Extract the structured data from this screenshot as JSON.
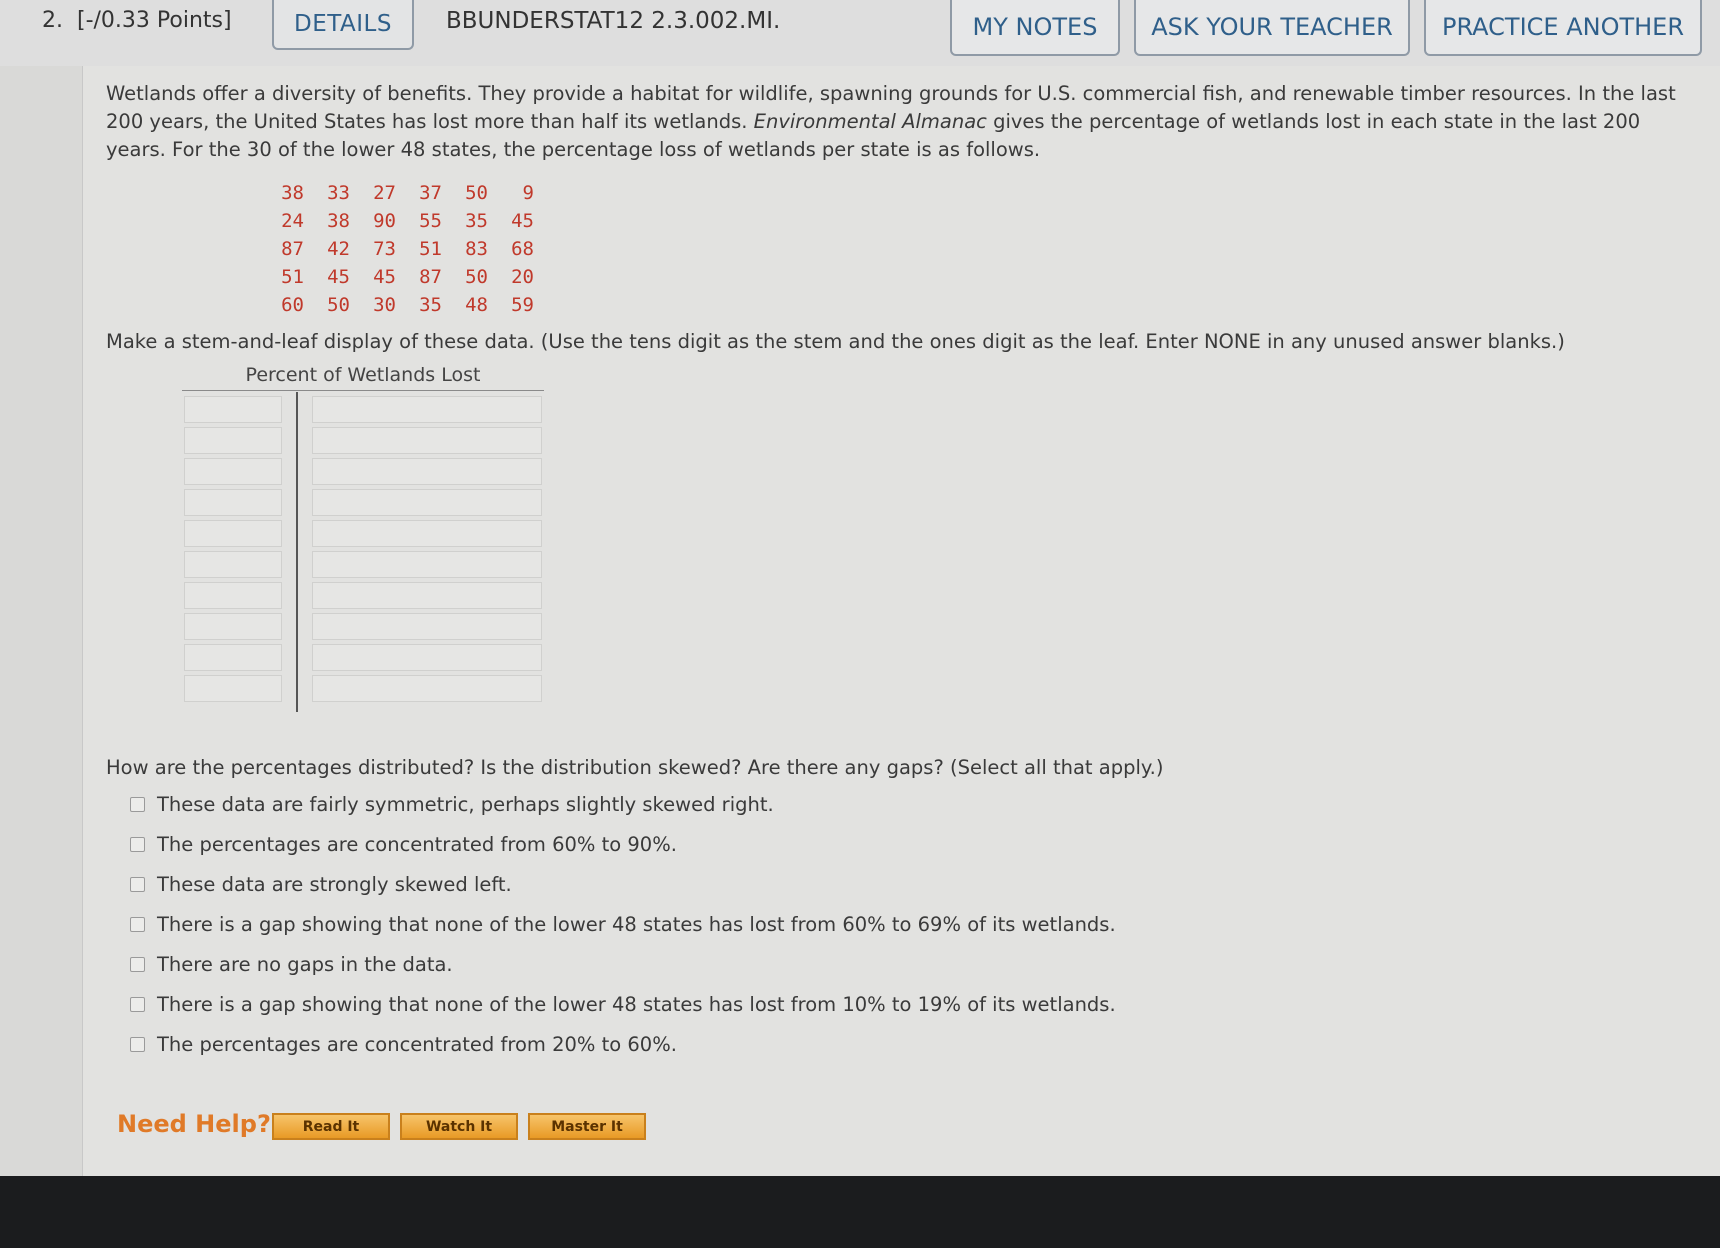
{
  "header": {
    "question_number": "2.",
    "points": "[-/0.33 Points]",
    "details": "DETAILS",
    "code": "BBUNDERSTAT12 2.3.002.MI.",
    "my_notes": "MY NOTES",
    "ask_teacher": "ASK YOUR TEACHER",
    "practice_another": "PRACTICE ANOTHER"
  },
  "problem": {
    "intro_part1": "Wetlands offer a diversity of benefits. They provide a habitat for wildlife, spawning grounds for U.S. commercial fish, and renewable timber resources. In the last 200 years, the United States has lost more than half its wetlands.",
    "source_italic": "Environmental Almanac",
    "intro_part2": "gives the percentage of wetlands lost in each state in the last 200 years. For the 30 of the lower 48 states, the percentage loss of wetlands per state is as follows.",
    "data_rows": [
      [
        "38",
        "33",
        "27",
        "37",
        "50",
        "9"
      ],
      [
        "24",
        "38",
        "90",
        "55",
        "35",
        "45"
      ],
      [
        "87",
        "42",
        "73",
        "51",
        "83",
        "68"
      ],
      [
        "51",
        "45",
        "45",
        "87",
        "50",
        "20"
      ],
      [
        "60",
        "50",
        "30",
        "35",
        "48",
        "59"
      ]
    ],
    "instruction": "Make a stem-and-leaf display of these data. (Use the tens digit as the stem and the ones digit as the leaf. Enter NONE in any unused answer blanks.)",
    "table_title": "Percent of Wetlands Lost"
  },
  "mc": {
    "question": "How are the percentages distributed? Is the distribution skewed? Are there any gaps? (Select all that apply.)",
    "options": [
      "These data are fairly symmetric, perhaps slightly skewed right.",
      "The percentages are concentrated from 60% to 90%.",
      "These data are strongly skewed left.",
      "There is a gap showing that none of the lower 48 states has lost from 60% to 69% of its wetlands.",
      "There are no gaps in the data.",
      "There is a gap showing that none of the lower 48 states has lost from 10% to 19% of its wetlands.",
      "The percentages are concentrated from 20% to 60%."
    ]
  },
  "help": {
    "label": "Need Help?",
    "read": "Read It",
    "watch": "Watch It",
    "master": "Master It"
  }
}
